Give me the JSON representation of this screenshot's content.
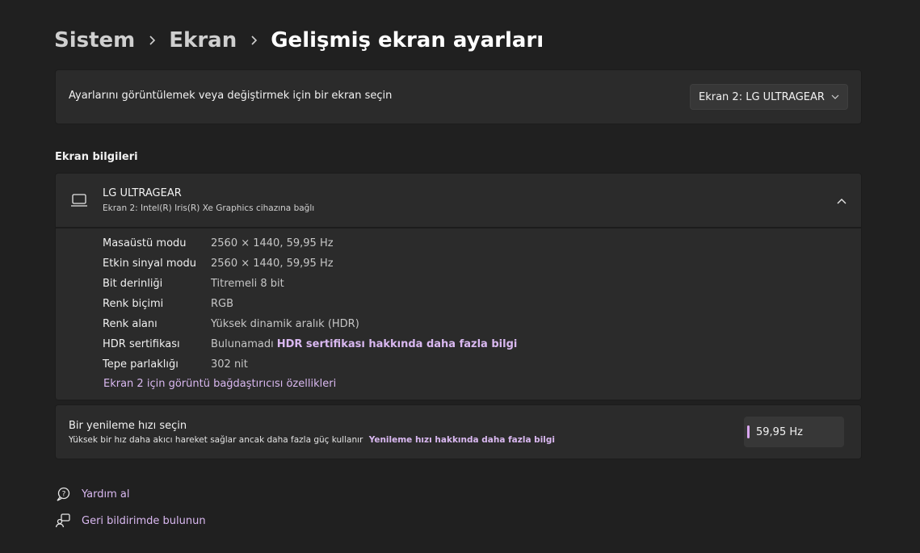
{
  "breadcrumb": {
    "items": [
      "Sistem",
      "Ekran"
    ],
    "current": "Gelişmiş ekran ayarları"
  },
  "display_select": {
    "label": "Ayarlarını görüntülemek veya değiştirmek için bir ekran seçin",
    "selected": "Ekran 2: LG ULTRAGEAR"
  },
  "display_info": {
    "section_title": "Ekran bilgileri",
    "name": "LG ULTRAGEAR",
    "subtitle": "Ekran 2: Intel(R) Iris(R) Xe Graphics cihazına bağlı",
    "rows": [
      {
        "key": "Masaüstü modu",
        "value": "2560 × 1440, 59,95 Hz"
      },
      {
        "key": "Etkin sinyal modu",
        "value": "2560 × 1440, 59,95 Hz"
      },
      {
        "key": "Bit derinliği",
        "value": "Titremeli 8 bit"
      },
      {
        "key": "Renk biçimi",
        "value": "RGB"
      },
      {
        "key": "Renk alanı",
        "value": "Yüksek dinamik aralık (HDR)"
      },
      {
        "key": "HDR sertifikası",
        "value": "Bulunamadı",
        "link": "HDR sertifikası hakkında daha fazla bilgi"
      },
      {
        "key": "Tepe parlaklığı",
        "value": "302 nit"
      }
    ],
    "adapter_link": "Ekran 2 için görüntü bağdaştırıcısı özellikleri"
  },
  "refresh_rate": {
    "title": "Bir yenileme hızı seçin",
    "description": "Yüksek bir hız daha akıcı hareket sağlar ancak daha fazla güç kullanır",
    "link": "Yenileme hızı hakkında daha fazla bilgi",
    "value": "59,95 Hz"
  },
  "footer": {
    "help": "Yardım al",
    "feedback": "Geri bildirimde bulunun"
  },
  "colors": {
    "background": "#202020",
    "card": "#2b2b2b",
    "accent": "#d9b8f0"
  }
}
